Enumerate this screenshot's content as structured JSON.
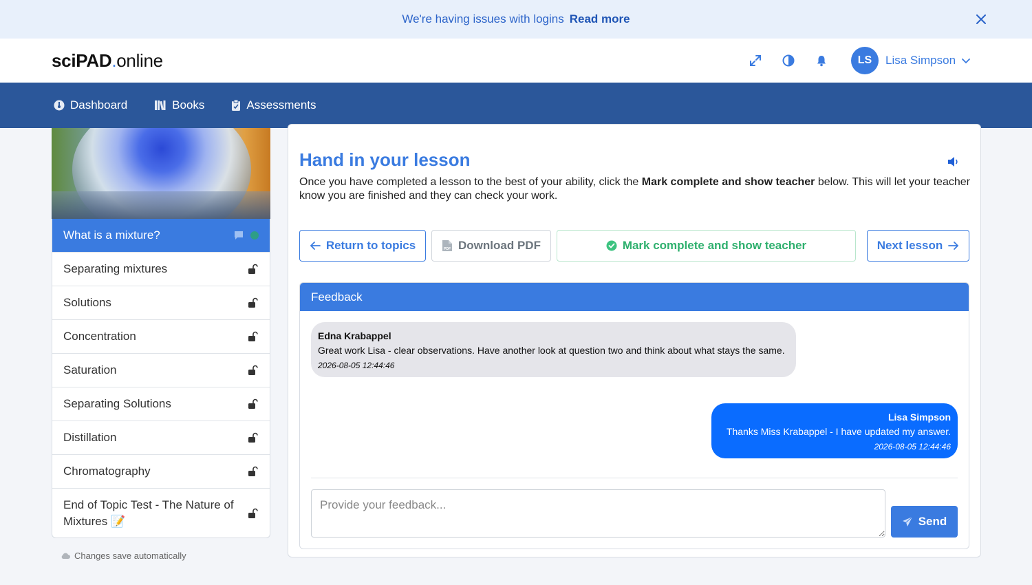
{
  "alert": {
    "message": "We're having issues with logins",
    "link": "Read more"
  },
  "header": {
    "logo_bold": "sciPAD",
    "logo_dot": ".",
    "logo_rest": "online",
    "user": {
      "initials": "LS",
      "name": "Lisa Simpson"
    }
  },
  "nav": {
    "items": [
      {
        "label": "Dashboard",
        "icon": "dashboard-icon"
      },
      {
        "label": "Books",
        "icon": "books-icon"
      },
      {
        "label": "Assessments",
        "icon": "clipboard-icon"
      }
    ]
  },
  "sidebar": {
    "lessons": [
      {
        "label": "What is a mixture?",
        "status": "active"
      },
      {
        "label": "Separating mixtures",
        "status": "unlocked"
      },
      {
        "label": "Solutions",
        "status": "unlocked"
      },
      {
        "label": "Concentration",
        "status": "unlocked"
      },
      {
        "label": "Saturation",
        "status": "unlocked"
      },
      {
        "label": "Separating Solutions",
        "status": "unlocked"
      },
      {
        "label": "Distillation",
        "status": "unlocked"
      },
      {
        "label": "Chromatography",
        "status": "unlocked"
      },
      {
        "label": "End of Topic Test - The Nature of Mixtures 📝",
        "status": "unlocked"
      }
    ],
    "save_note": "Changes save automatically"
  },
  "main": {
    "title": "Hand in your lesson",
    "desc_before": "Once you have completed a lesson to the best of your ability, click the ",
    "desc_bold": "Mark complete and show teacher",
    "desc_after": " below. This will let your teacher know you are finished and they can check your work.",
    "buttons": {
      "return": "Return to topics",
      "pdf": "Download PDF",
      "complete": "Mark complete and show teacher",
      "next": "Next lesson"
    }
  },
  "feedback": {
    "header": "Feedback",
    "messages": [
      {
        "author": "Edna Krabappel",
        "text": "Great work Lisa - clear observations. Have another look at question two and think about what stays the same.",
        "time": "2026-08-05 12:44:46"
      },
      {
        "author": "Lisa Simpson",
        "text": "Thanks Miss Krabappel - I have updated my answer.",
        "time": "2026-08-05 12:44:46"
      }
    ],
    "placeholder": "Provide your feedback...",
    "send": "Send"
  },
  "colors": {
    "primary": "#3a7be0",
    "nav": "#2b579a",
    "success": "#2fb06e",
    "alert_bg": "#e8f0fb"
  }
}
